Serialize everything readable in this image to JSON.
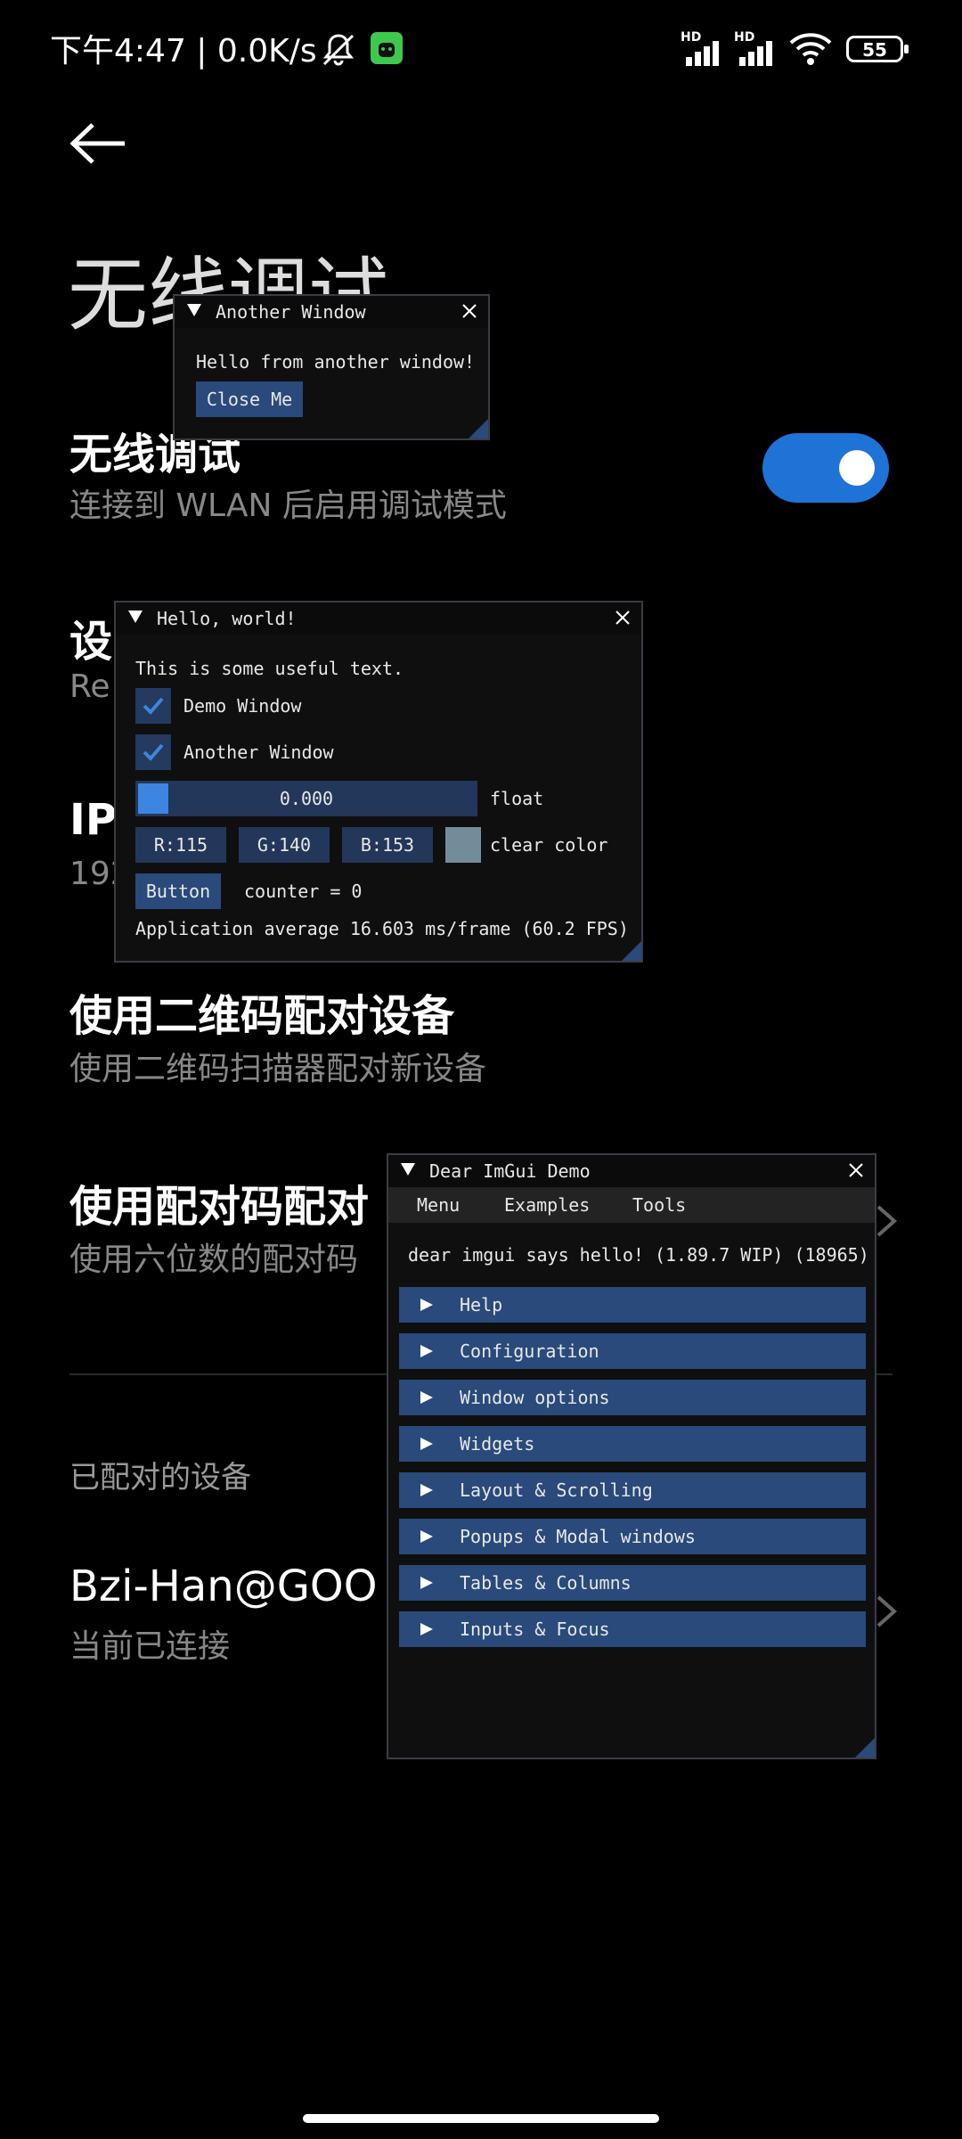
{
  "status_bar": {
    "time_and_speed": "下午4:47 | 0.0K/s",
    "signal_label": "HD",
    "battery": "55"
  },
  "page": {
    "title": "无线调试",
    "rows": [
      {
        "title": "无线调试",
        "subtitle": "连接到 WLAN 后启用调试模式"
      },
      {
        "title": "设",
        "subtitle": "Re"
      },
      {
        "title": "IP",
        "subtitle": "192"
      },
      {
        "title": "使用二维码配对设备",
        "subtitle": "使用二维码扫描器配对新设备"
      },
      {
        "title": "使用配对码配对",
        "subtitle": "使用六位数的配对码"
      }
    ],
    "paired_section": "已配对的设备",
    "paired_device": {
      "title": "Bzi-Han@GOO",
      "subtitle": "当前已连接"
    },
    "toggle_on": true
  },
  "another_window": {
    "title": "Another Window",
    "text": "Hello from another window!",
    "close_button": "Close Me"
  },
  "hello_window": {
    "title": "Hello, world!",
    "text": "This is some useful text.",
    "checkbox_demo": "Demo Window",
    "checkbox_demo_checked": true,
    "checkbox_another": "Another Window",
    "checkbox_another_checked": true,
    "slider_value": "0.000",
    "slider_label": "float",
    "color_r": "R:115",
    "color_g": "G:140",
    "color_b": "B:153",
    "color_label": "clear color",
    "color_swatch": "#738c99",
    "button": "Button",
    "counter": "counter = 0",
    "fps": "Application average 16.603 ms/frame (60.2 FPS)"
  },
  "demo_window": {
    "title": "Dear ImGui Demo",
    "menu": [
      "Menu",
      "Examples",
      "Tools"
    ],
    "hello": "dear imgui says hello! (1.89.7 WIP) (18965)",
    "headers": [
      "Help",
      "Configuration",
      "Window options",
      "Widgets",
      "Layout & Scrolling",
      "Popups & Modal windows",
      "Tables & Columns",
      "Inputs & Focus"
    ]
  },
  "colors": {
    "accent": "#1f72d6",
    "imgui_button": "#294a7a",
    "imgui_frame": "#223759",
    "imgui_check": "#3d85e0"
  }
}
